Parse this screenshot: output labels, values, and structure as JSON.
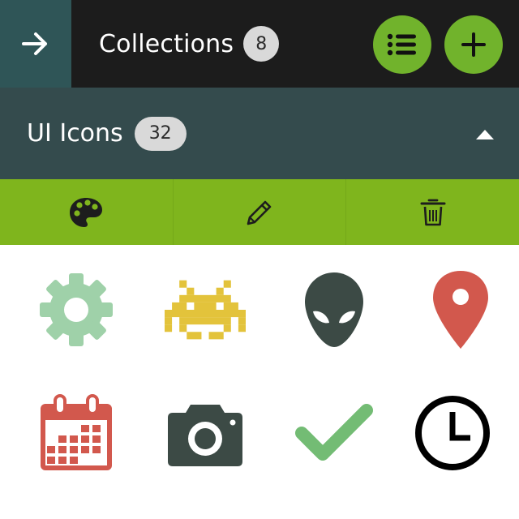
{
  "header": {
    "back_icon": "arrow-right-icon",
    "title": "Collections",
    "count": "8",
    "list_button_icon": "list-icon",
    "add_button_icon": "plus-icon",
    "colors": {
      "bar": "#1c1c1c",
      "back_bg": "#2f5557",
      "accent": "#71b32c"
    }
  },
  "collection": {
    "title": "UI Icons",
    "count": "32",
    "toggle_icon": "caret-up-icon",
    "color": "#344b4d"
  },
  "actions": {
    "color": "#7fb51d",
    "items": [
      {
        "icon": "palette-icon"
      },
      {
        "icon": "pencil-icon"
      },
      {
        "icon": "trash-icon"
      }
    ]
  },
  "icons": [
    {
      "name": "gear-icon",
      "color": "#9fd1a9"
    },
    {
      "name": "space-invader-icon",
      "color": "#e3c33b"
    },
    {
      "name": "alien-icon",
      "color": "#3c4a45"
    },
    {
      "name": "map-pin-icon",
      "color": "#d2584d"
    },
    {
      "name": "calendar-icon",
      "color": "#d2584d"
    },
    {
      "name": "camera-icon",
      "color": "#3c4a45"
    },
    {
      "name": "checkmark-icon",
      "color": "#73bc74"
    },
    {
      "name": "clock-icon",
      "color": "#000000"
    }
  ]
}
